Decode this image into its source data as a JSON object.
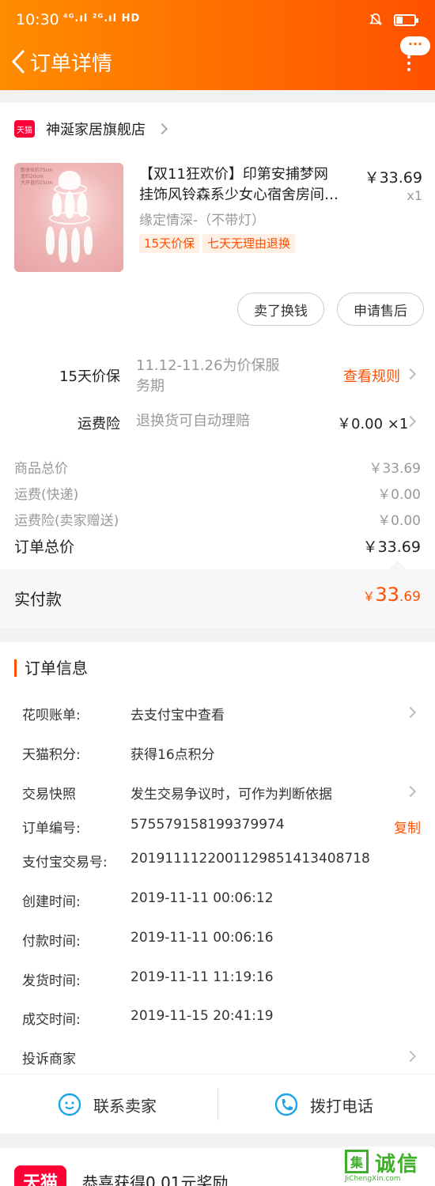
{
  "status_bar": {
    "time": "10:30",
    "signal_text": "⁴ᴳ.ıl ²ᴳ.ıl HD",
    "battery_level": 0.35
  },
  "header": {
    "title": "订单详情",
    "more_bubble": "···"
  },
  "store": {
    "logo_text": "天猫",
    "name": "神涎家居旗舰店"
  },
  "product": {
    "image_caption": "整体长约75cm\n宽约20cm\n大环直约15cm",
    "title_line1": "【双11狂欢价】印第安捕梦网",
    "title_line2": "挂饰风铃森系少女心宿舍房间…",
    "price": "￥33.69",
    "qty": "x1",
    "sku": "缘定情深-（不带灯）",
    "tags": [
      "15天价保",
      "七天无理由退换"
    ]
  },
  "actions": {
    "sell_label": "卖了换钱",
    "aftersale_label": "申请售后"
  },
  "price_protect": {
    "label": "15天价保",
    "desc_line1": "11.12-11.26为价保服",
    "desc_line2": "务期",
    "link": "查看规则"
  },
  "freight_insurance": {
    "label": "运费险",
    "desc": "退换货可自动理赔",
    "value": "￥0.00 ×1"
  },
  "summary": {
    "rows": [
      {
        "label": "商品总价",
        "value": "￥33.69"
      },
      {
        "label": "运费(快递)",
        "value": "￥0.00"
      },
      {
        "label": "运费险(卖家赠送)",
        "value": "￥0.00"
      }
    ],
    "total_label": "订单总价",
    "total_value": "￥33.69",
    "paid_label": "实付款",
    "paid_currency": "￥",
    "paid_int": "33",
    "paid_dec": ".69"
  },
  "order_info": {
    "title": "订单信息",
    "rows": [
      {
        "label": "花呗账单:",
        "value": "去支付宝中查看"
      },
      {
        "label": "天猫积分:",
        "value": "获得16点积分"
      },
      {
        "label": "交易快照",
        "value": "发生交易争议时，可作为判断依据"
      },
      {
        "label": "订单编号:",
        "value": "575579158199379974"
      },
      {
        "label": "支付宝交易号:",
        "value": "2019111122001129851413408718"
      },
      {
        "label": "创建时间:",
        "value": "2019-11-11 00:06:12"
      },
      {
        "label": "付款时间:",
        "value": "2019-11-11 00:06:16"
      },
      {
        "label": "发货时间:",
        "value": "2019-11-11 11:19:16"
      },
      {
        "label": "成交时间:",
        "value": "2019-11-15 20:41:19"
      },
      {
        "label": "投诉商家",
        "value": ""
      }
    ],
    "copy_label": "复制"
  },
  "contact": {
    "seller_label": "联系卖家",
    "phone_label": "拨打电话"
  },
  "bottom": {
    "logo_text": "天猫",
    "reward_text": "恭喜获得0.01元奖励"
  },
  "watermark": {
    "box_char": "集",
    "text": "诚信",
    "sub": "JiChengXin.com"
  },
  "colors": {
    "accent": "#ff5000",
    "header_start": "#ff8c00",
    "header_end": "#ff5000",
    "tmall_red": "#ff0036"
  }
}
